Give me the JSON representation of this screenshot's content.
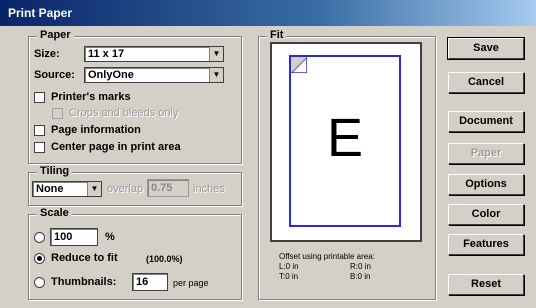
{
  "title": "Print Paper",
  "paper": {
    "group_label": "Paper",
    "size_label": "Size:",
    "size_value": "11 x 17",
    "source_label": "Source:",
    "source_value": "OnlyOne",
    "printers_marks": "Printer's marks",
    "crops_bleeds": "Crops and bleeds only",
    "page_information": "Page information",
    "center_page": "Center page in print area"
  },
  "tiling": {
    "group_label": "Tiling",
    "value": "None",
    "overlap_label": "overlap",
    "overlap_value": "0.75",
    "inches_label": "inches"
  },
  "scale": {
    "group_label": "Scale",
    "percent_value": "100",
    "percent_sign": "%",
    "reduce_label": "Reduce to fit",
    "reduce_percent": "(100.0%)",
    "thumbnails_label": "Thumbnails:",
    "thumbnails_value": "16",
    "per_page_label": "per page",
    "selected": "reduce"
  },
  "fit": {
    "group_label": "Fit",
    "preview_letter": "E",
    "offset_caption": "Offset using printable area:",
    "l": "L:0 in",
    "r": "R:0 in",
    "t": "T:0 in",
    "b": "B:0 in"
  },
  "buttons": {
    "save": "Save",
    "cancel": "Cancel",
    "document": "Document",
    "paper": "Paper",
    "options": "Options",
    "color": "Color",
    "features": "Features",
    "reset": "Reset"
  },
  "colors": {
    "title_bar": "#0a246a",
    "page_outline": "#2a2ae0",
    "dialog_bg": "#d4d0c8"
  }
}
